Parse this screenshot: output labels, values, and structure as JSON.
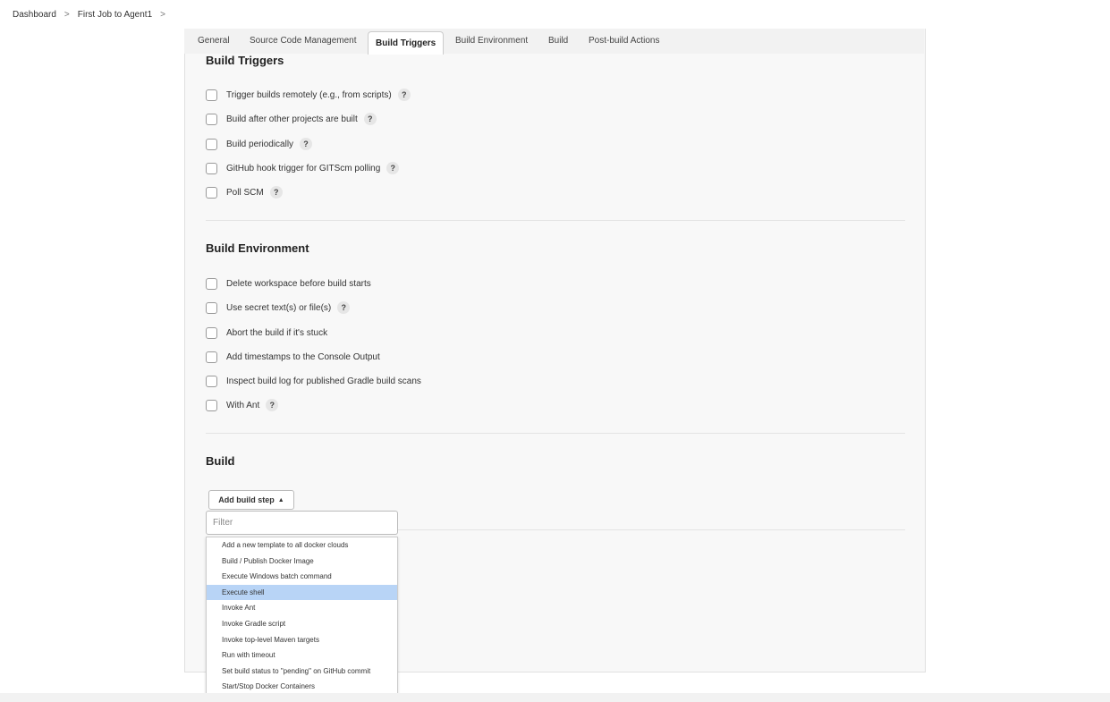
{
  "breadcrumb": {
    "items": [
      "Dashboard",
      "First Job to Agent1"
    ],
    "separator": ">"
  },
  "tabs": [
    "General",
    "Source Code Management",
    "Build Triggers",
    "Build Environment",
    "Build",
    "Post-build Actions"
  ],
  "active_tab": "Build Triggers",
  "build_triggers": {
    "title": "Build Triggers",
    "options": [
      {
        "label": "Trigger builds remotely (e.g., from scripts)",
        "checked": false,
        "help": "?"
      },
      {
        "label": "Build after other projects are built",
        "checked": false,
        "help": "?"
      },
      {
        "label": "Build periodically",
        "checked": false,
        "help": "?"
      },
      {
        "label": "GitHub hook trigger for GITScm polling",
        "checked": false,
        "help": "?"
      },
      {
        "label": "Poll SCM",
        "checked": false,
        "help": "?"
      }
    ]
  },
  "build_environment": {
    "title": "Build Environment",
    "options": [
      {
        "label": "Delete workspace before build starts",
        "checked": false
      },
      {
        "label": "Use secret text(s) or file(s)",
        "checked": false,
        "help": "?"
      },
      {
        "label": "Abort the build if it's stuck",
        "checked": false
      },
      {
        "label": "Add timestamps to the Console Output",
        "checked": false
      },
      {
        "label": "Inspect build log for published Gradle build scans",
        "checked": false
      },
      {
        "label": "With Ant",
        "checked": false,
        "help": "?"
      }
    ]
  },
  "build": {
    "title": "Build",
    "add_step_label": "Add build step",
    "filter_placeholder": "Filter",
    "menu_items": [
      "Add a new template to all docker clouds",
      "Build / Publish Docker Image",
      "Execute Windows batch command",
      "Execute shell",
      "Invoke Ant",
      "Invoke Gradle script",
      "Invoke top-level Maven targets",
      "Run with timeout",
      "Set build status to \"pending\" on GitHub commit",
      "Start/Stop Docker Containers"
    ],
    "highlighted_item": "Execute shell"
  },
  "colors": {
    "highlight": "#b8d4f6",
    "panel": "#f8f8f8"
  }
}
